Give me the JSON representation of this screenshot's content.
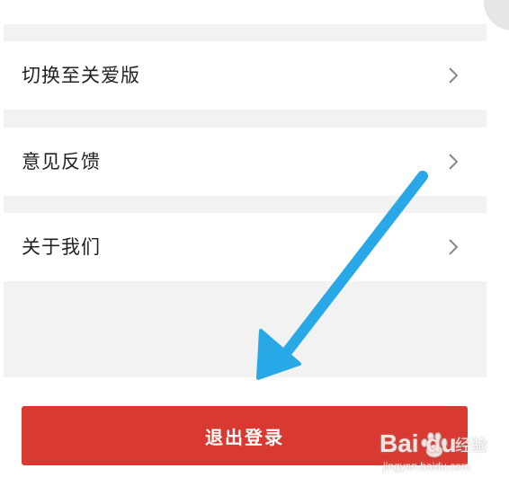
{
  "menu": {
    "items": [
      {
        "label": "切换至关爱版"
      },
      {
        "label": "意见反馈"
      },
      {
        "label": "关于我们"
      }
    ]
  },
  "logout": {
    "label": "退出登录"
  },
  "colors": {
    "logout_bg": "#d83a31",
    "arrow": "#29a8e8",
    "separator": "#f2f2f2"
  },
  "watermark": {
    "main": "Bai du",
    "cn": "经验",
    "sub": "jingyan.baidu.com"
  },
  "icons": [
    "chevron-right-icon",
    "pointer-arrow-icon",
    "baidu-paw-icon"
  ]
}
